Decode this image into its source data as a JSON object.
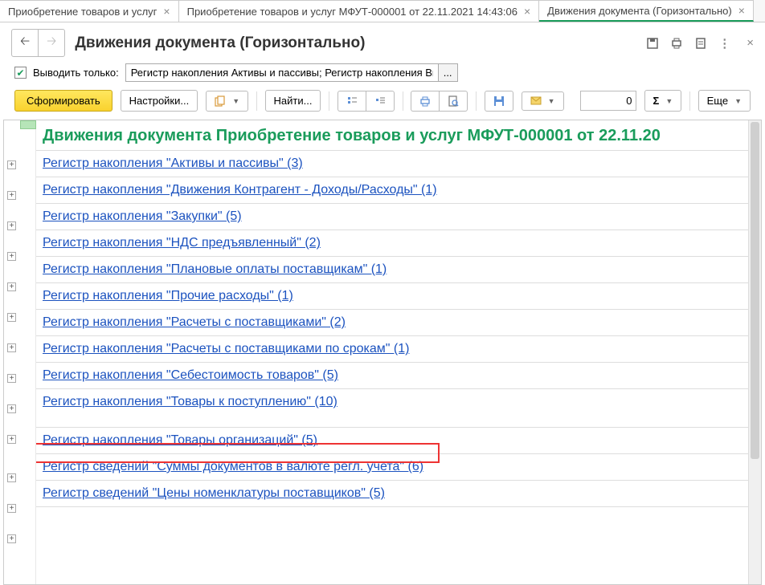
{
  "tabs": [
    {
      "label": "Приобретение товаров и услуг",
      "active": false
    },
    {
      "label": "Приобретение товаров и услуг МФУТ-000001 от 22.11.2021 14:43:06",
      "active": false
    },
    {
      "label": "Движения документа (Горизонтально)",
      "active": true
    }
  ],
  "header": {
    "title": "Движения документа (Горизонтально)"
  },
  "filter": {
    "checkbox_label": "Выводить только:",
    "value": "Регистр накопления Активы и пассивы; Регистр накопления Вы"
  },
  "toolbar": {
    "generate": "Сформировать",
    "settings": "Настройки...",
    "find": "Найти...",
    "number": "0",
    "more": "Еще"
  },
  "report": {
    "title": "Движения документа Приобретение товаров и услуг МФУТ-000001 от 22.11.20",
    "rows": [
      "Регистр накопления \"Активы и пассивы\" (3)",
      "Регистр накопления \"Движения Контрагент - Доходы/Расходы\" (1)",
      "Регистр накопления \"Закупки\" (5)",
      "Регистр накопления \"НДС предъявленный\" (2)",
      "Регистр накопления \"Плановые оплаты поставщикам\" (1)",
      "Регистр накопления \"Прочие расходы\" (1)",
      "Регистр накопления \"Расчеты с поставщиками\" (2)",
      "Регистр накопления \"Расчеты с поставщиками по срокам\" (1)",
      "Регистр накопления \"Себестоимость товаров\" (5)",
      "Регистр накопления \"Товары к поступлению\" (10)",
      "Регистр накопления \"Товары организаций\" (5)",
      "Регистр сведений \"Суммы документов в валюте регл. учета\" (6)",
      "Регистр сведений \"Цены номенклатуры поставщиков\" (5)"
    ]
  }
}
